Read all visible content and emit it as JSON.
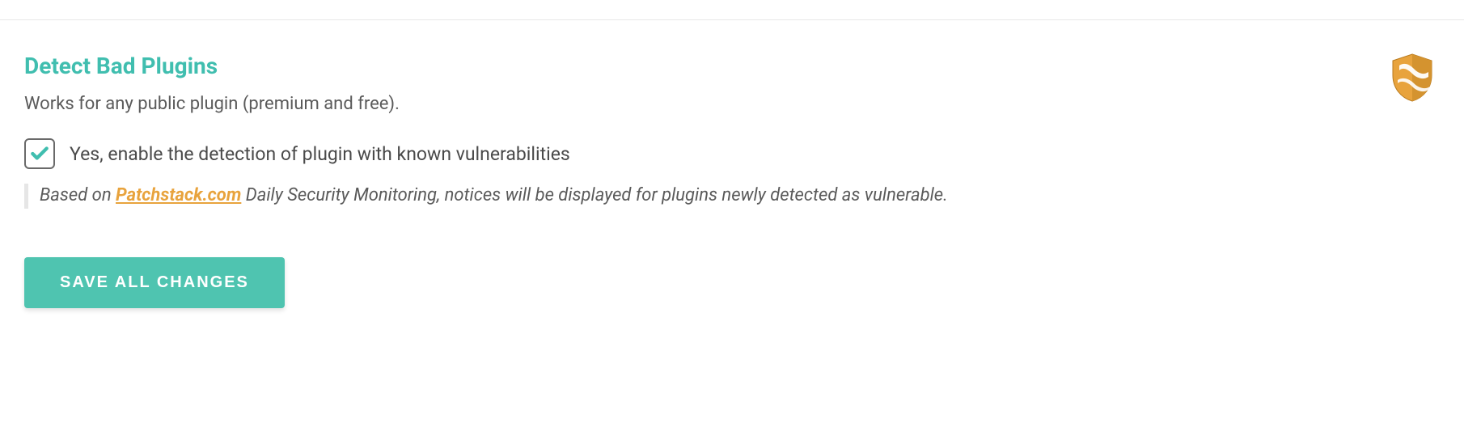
{
  "section": {
    "title": "Detect Bad Plugins",
    "subtitle": "Works for any public plugin (premium and free)."
  },
  "checkbox": {
    "checked": true,
    "label": "Yes, enable the detection of plugin with known vulnerabilities"
  },
  "note": {
    "prefix": "Based on ",
    "link_text": "Patchstack.com",
    "suffix": " Daily Security Monitoring, notices will be displayed for plugins newly detected as vulnerable."
  },
  "actions": {
    "save_label": "SAVE ALL CHANGES"
  },
  "colors": {
    "accent": "#40beaf",
    "link": "#e8a33d"
  }
}
